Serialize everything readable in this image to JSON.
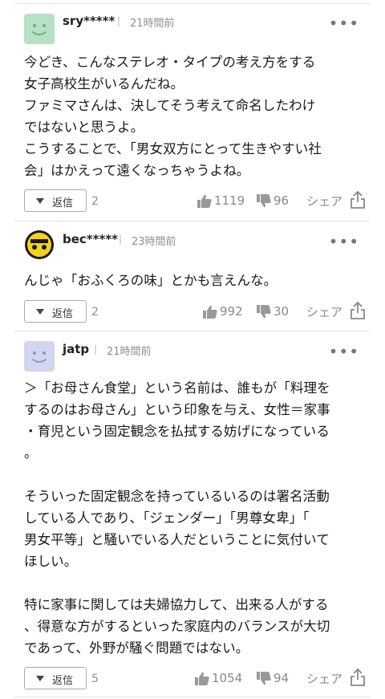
{
  "comments": [
    {
      "user": "sry*****",
      "time": "21時間前",
      "separator": "|",
      "avatar_icon": "smiley-face-icon",
      "text": "今どき、こんなステレオ・タイプの考え方をする\n女子高校生がいるんだね。\nファミマさんは、決してそう考えて命名したわけ\nではないと思うよ。\nこうすることで、「男女双方にとって生きやすい社\n会」はかえって遠くなっちゃうよね。",
      "reply_label": "返信",
      "reply_count": "2",
      "likes": "1119",
      "dislikes": "96",
      "share_label": "シェア",
      "more": "•••"
    },
    {
      "user": "bec*****",
      "time": "23時間前",
      "separator": "|",
      "avatar_icon": "custom-yellow-avatar-icon",
      "text": "んじゃ「おふくろの味」とかも言えんな。",
      "reply_label": "返信",
      "reply_count": "2",
      "likes": "992",
      "dislikes": "30",
      "share_label": "シェア",
      "more": "•••"
    },
    {
      "user": "jatp",
      "time": "21時間前",
      "separator": "|",
      "avatar_icon": "smiley-face-icon",
      "text": "＞「お母さん食堂」という名前は、誰もが「料理を\nするのはお母さん」という印象を与え、女性＝家事\n・育児という固定観念を払拭する妨げになっている\n。\n\nそういった固定観念を持っているいるのは署名活動\nしている人であり、「ジェンダー」「男尊女卑」「\n男女平等」と騒いでいる人だということに気付いて\nほしい。\n\n特に家事に関しては夫婦協力して、出来る人がする\n、得意な方がするといった家庭内のバランスが大切\nであって、外野が騒ぐ問題ではない。",
      "reply_label": "返信",
      "reply_count": "5",
      "likes": "1054",
      "dislikes": "94",
      "share_label": "シェア",
      "more": "•••"
    }
  ]
}
